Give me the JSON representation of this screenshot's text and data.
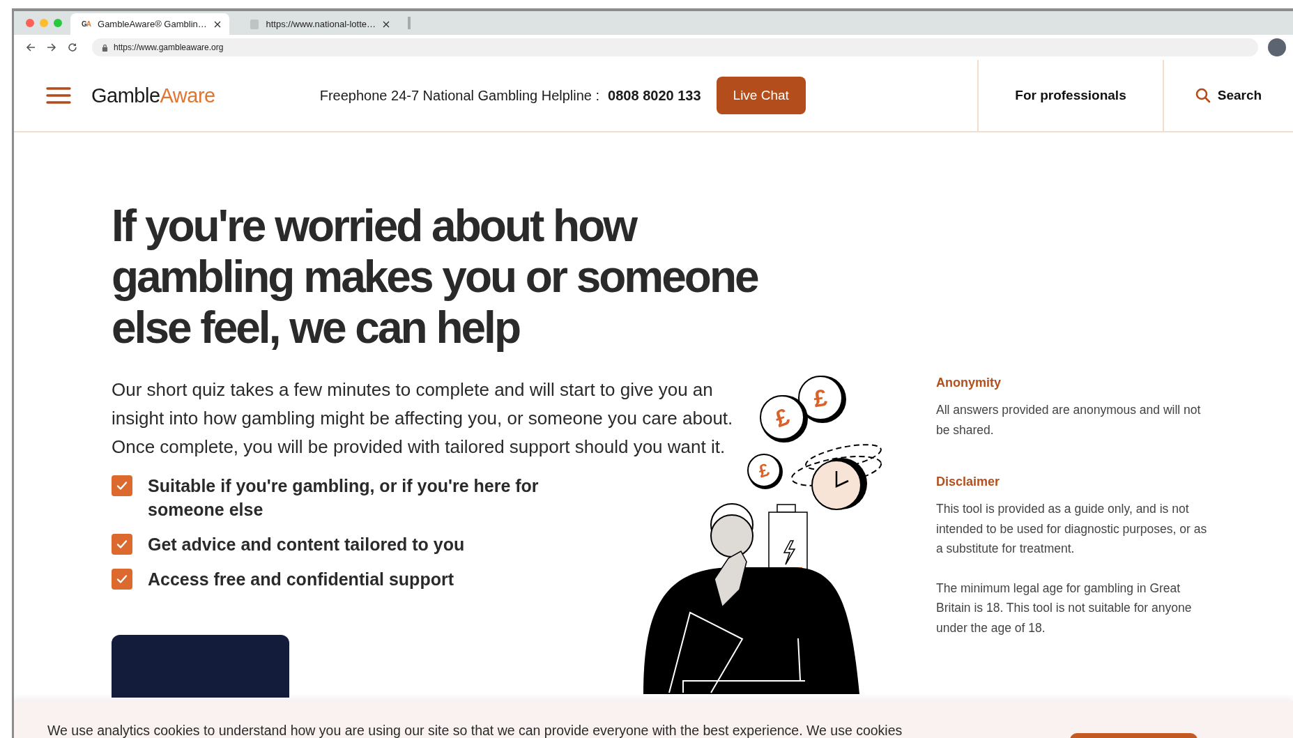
{
  "browser": {
    "tabs": [
      {
        "favicon": [
          "G",
          "A"
        ],
        "title": "GambleAware® Gamblin…",
        "selected": true
      },
      {
        "title": "https://www.national-lotte…",
        "selected": false
      }
    ],
    "url": "https://www.gambleaware.org"
  },
  "header": {
    "logo": [
      "Gamble",
      "Aware"
    ],
    "helpline_label": "Freephone 24-7 National Gambling Helpline :",
    "helpline_number": "0808 8020 133",
    "live_chat": "Live Chat",
    "nav": [
      {
        "label": "For professionals",
        "kind": "link"
      },
      {
        "label": "Search",
        "kind": "search"
      }
    ]
  },
  "hero": {
    "heading": "If you're worried about how gambling makes you or someone else feel, we can help",
    "intro": "Our short quiz takes a few minutes to complete and will start to give you an insight into how gambling might be affecting you, or someone you care about. Once complete, you will be provided with tailored support should you want it.",
    "checklist": [
      {
        "text": "Suitable if you're gambling, or if you're here for someone else",
        "checked": true
      },
      {
        "text": "Get advice and content tailored to you",
        "checked": true
      },
      {
        "text": "Access free and confidential support",
        "checked": true
      }
    ]
  },
  "side_notes": [
    {
      "title": "Anonymity",
      "paragraphs": [
        "All answers provided are anonymous and will not be shared."
      ]
    },
    {
      "title": "Disclaimer",
      "paragraphs": [
        "This tool is provided as a guide only, and is not intended to be used for diagnostic purposes, or as a substitute for treatment.",
        "The minimum legal age for gambling in Great Britain is 18. This tool is not suitable for anyone under the age of 18."
      ]
    }
  ],
  "illustration": {
    "coin_symbols": [
      "£",
      "£",
      "£"
    ]
  },
  "cookie_banner": {
    "text": "We use analytics cookies to understand how you are using our site so that we can provide everyone with the best experience. We use cookies"
  }
}
